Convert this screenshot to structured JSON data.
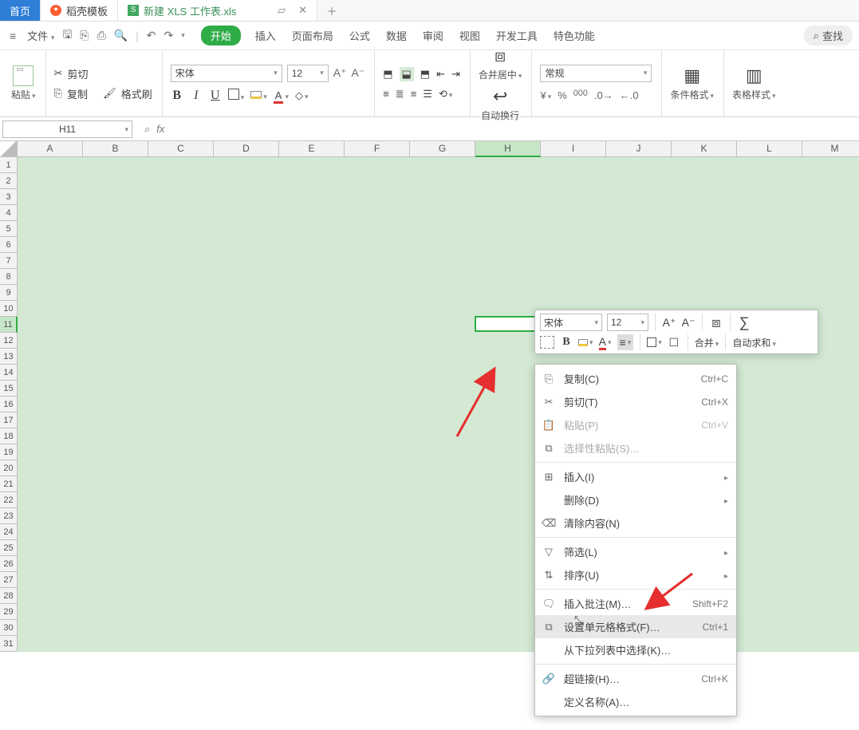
{
  "tabs": {
    "home": "首页",
    "template": "稻壳模板",
    "doc": "新建 XLS 工作表.xls"
  },
  "file_menu": "文件",
  "menu": {
    "start": "开始",
    "insert": "插入",
    "layout": "页面布局",
    "formula": "公式",
    "data": "数据",
    "review": "审阅",
    "view": "视图",
    "developer": "开发工具",
    "special": "特色功能",
    "search": "查找"
  },
  "ribbon": {
    "paste": "粘贴",
    "cut": "剪切",
    "copy": "复制",
    "brush": "格式刷",
    "font": "宋体",
    "size": "12",
    "merge": "合并居中",
    "wrap": "自动换行",
    "numfmt": "常规",
    "condfmt": "条件格式",
    "tablefmt": "表格样式"
  },
  "namebox": "H11",
  "cols": [
    "A",
    "B",
    "C",
    "D",
    "E",
    "F",
    "G",
    "H",
    "I",
    "J",
    "K",
    "L",
    "M"
  ],
  "rows_count": 31,
  "selected": {
    "col": "H",
    "row": 11
  },
  "minitool": {
    "font": "宋体",
    "size": "12",
    "merge": "合并",
    "autosum": "自动求和"
  },
  "ctx": {
    "copy": "复制(C)",
    "copy_s": "Ctrl+C",
    "cut": "剪切(T)",
    "cut_s": "Ctrl+X",
    "paste": "粘贴(P)",
    "paste_s": "Ctrl+V",
    "pastespec": "选择性粘贴(S)…",
    "insert": "插入(I)",
    "delete": "删除(D)",
    "clear": "清除内容(N)",
    "filter": "筛选(L)",
    "sort": "排序(U)",
    "comment": "插入批注(M)…",
    "comment_s": "Shift+F2",
    "format": "设置单元格格式(F)…",
    "format_s": "Ctrl+1",
    "picklist": "从下拉列表中选择(K)…",
    "hyperlink": "超链接(H)…",
    "hyperlink_s": "Ctrl+K",
    "defname": "定义名称(A)…"
  },
  "chart_data": null
}
